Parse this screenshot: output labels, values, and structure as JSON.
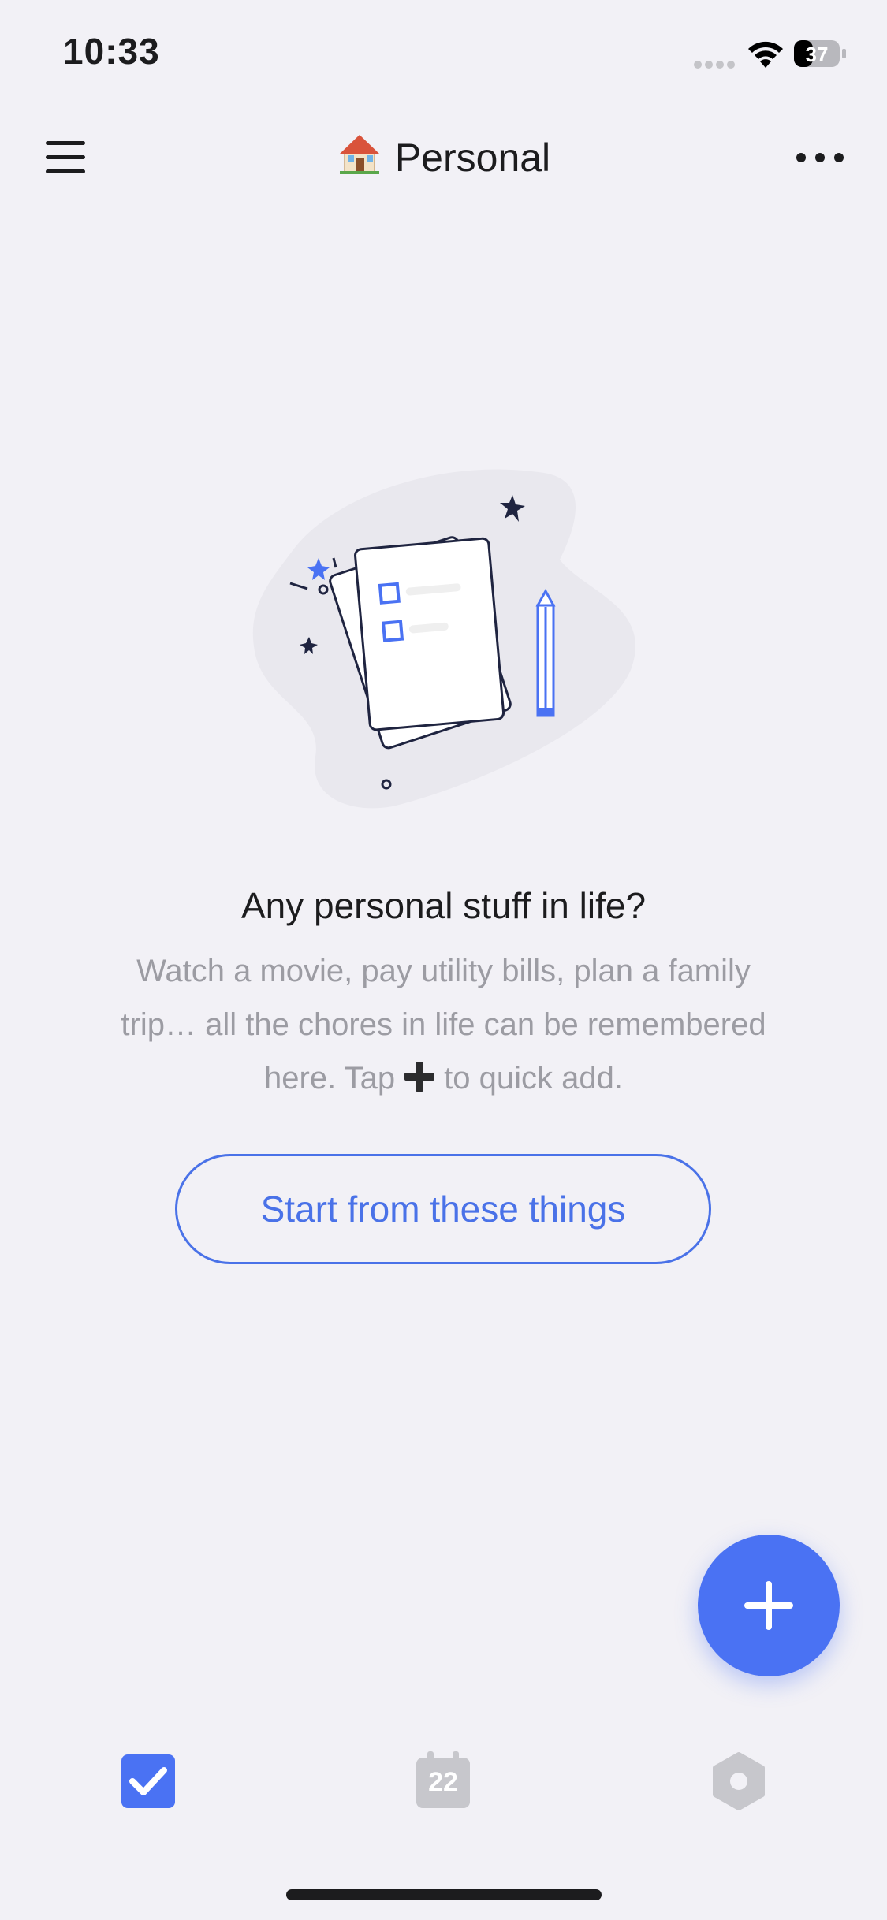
{
  "status_bar": {
    "time": "10:33",
    "battery_level": "37"
  },
  "header": {
    "title_emoji": "house-emoji-icon",
    "title": "Personal"
  },
  "empty_state": {
    "title": "Any personal stuff in life?",
    "description_before_icon": "Watch a movie, pay utility bills, plan a family trip… all the chores in life can be remembered here. Tap",
    "description_after_icon": "to quick add.",
    "start_button_label": "Start from these things"
  },
  "tab_bar": {
    "tabs": [
      {
        "name": "tasks",
        "icon": "checkbox-icon",
        "active": true
      },
      {
        "name": "calendar",
        "icon": "calendar-icon",
        "day": "22",
        "active": false
      },
      {
        "name": "settings",
        "icon": "hexagon-icon",
        "active": false
      }
    ]
  },
  "colors": {
    "accent": "#4a72f3",
    "background": "#f2f1f6",
    "inactive": "#c7c7cc",
    "muted_text": "#9c9ca3"
  }
}
